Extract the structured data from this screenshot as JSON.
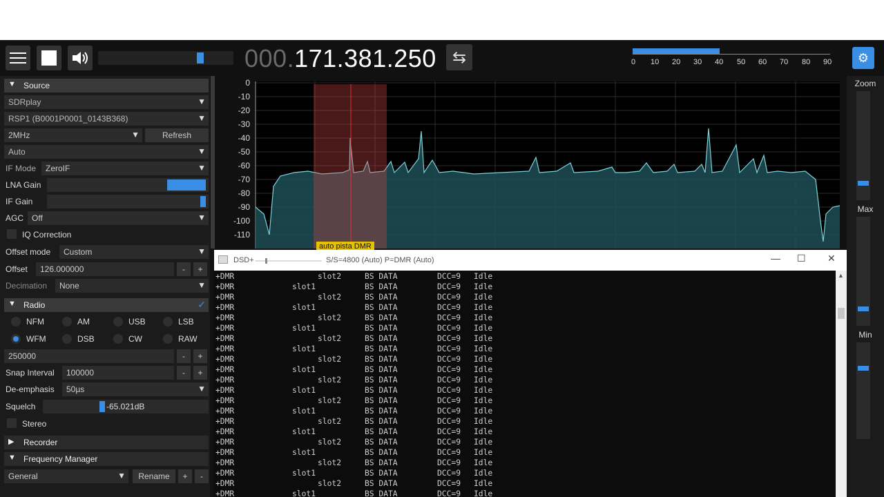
{
  "toolbar": {
    "menu_icon": "hamburger-icon",
    "stop_icon": "stop-icon",
    "volume_icon": "speaker-icon",
    "frequency_dim": "000.",
    "frequency_main": "171.381.250",
    "swap_icon": "swap-icon",
    "snr_scale": [
      "0",
      "10",
      "20",
      "30",
      "40",
      "50",
      "60",
      "70",
      "80",
      "90"
    ],
    "display_icon": "display-settings-icon",
    "accent_color": "#3a8ee6"
  },
  "source": {
    "header": "Source",
    "device": "SDRplay",
    "serial": "RSP1 (B0001P0001_0143B368)",
    "bandwidth": "2MHz",
    "refresh_label": "Refresh",
    "agc_mode": "Auto",
    "if_mode_label": "IF Mode",
    "if_mode_value": "ZeroIF",
    "lna_gain_label": "LNA Gain",
    "if_gain_label": "IF Gain",
    "agc_label": "AGC",
    "agc_value": "Off",
    "iq_correction_label": "IQ Correction",
    "offset_mode_label": "Offset mode",
    "offset_mode_value": "Custom",
    "offset_label": "Offset",
    "offset_value": "126.000000",
    "decimation_label": "Decimation",
    "decimation_value": "None",
    "minus": "-",
    "plus": "+"
  },
  "radio": {
    "header": "Radio",
    "modes_row1": [
      "NFM",
      "AM",
      "USB",
      "LSB"
    ],
    "modes_row2": [
      "WFM",
      "DSB",
      "CW",
      "RAW"
    ],
    "selected_mode": "WFM",
    "bandwidth_value": "250000",
    "snap_label": "Snap Interval",
    "snap_value": "100000",
    "deemph_label": "De-emphasis",
    "deemph_value": "50µs",
    "squelch_label": "Squelch",
    "squelch_value": "-65.021dB",
    "stereo_label": "Stereo"
  },
  "recorder": {
    "header": "Recorder"
  },
  "frequency_manager": {
    "header": "Frequency Manager",
    "list_value": "General",
    "rename_label": "Rename",
    "add_label": "+",
    "remove_label": "-"
  },
  "spectrum": {
    "db_ticks": [
      "0",
      "-10",
      "-20",
      "-30",
      "-40",
      "-50",
      "-60",
      "-70",
      "-80",
      "-90",
      "-100",
      "-110"
    ],
    "marker_label": "auto pista DMR",
    "trace_color": "#7fd4dc"
  },
  "right_panel": {
    "zoom_label": "Zoom",
    "max_label": "Max",
    "min_label": "Min"
  },
  "dsd_window": {
    "title": "DSD+",
    "status": "S/S=4800 (Auto) P=DMR (Auto)",
    "minimize": "—",
    "maximize": "☐",
    "close": "✕",
    "lines": [
      {
        "proto": "+DMR",
        "slot": "slot2",
        "type": "BS DATA",
        "dcc": "DCC=9",
        "state": "Idle",
        "indent": true
      },
      {
        "proto": "+DMR",
        "slot": "slot1",
        "type": "BS DATA",
        "dcc": "DCC=9",
        "state": "Idle",
        "indent": false
      },
      {
        "proto": "+DMR",
        "slot": "slot2",
        "type": "BS DATA",
        "dcc": "DCC=9",
        "state": "Idle",
        "indent": true
      },
      {
        "proto": "+DMR",
        "slot": "slot1",
        "type": "BS DATA",
        "dcc": "DCC=9",
        "state": "Idle",
        "indent": false
      },
      {
        "proto": "+DMR",
        "slot": "slot2",
        "type": "BS DATA",
        "dcc": "DCC=9",
        "state": "Idle",
        "indent": true
      },
      {
        "proto": "+DMR",
        "slot": "slot1",
        "type": "BS DATA",
        "dcc": "DCC=9",
        "state": "Idle",
        "indent": false
      },
      {
        "proto": "+DMR",
        "slot": "slot2",
        "type": "BS DATA",
        "dcc": "DCC=9",
        "state": "Idle",
        "indent": true
      },
      {
        "proto": "+DMR",
        "slot": "slot1",
        "type": "BS DATA",
        "dcc": "DCC=9",
        "state": "Idle",
        "indent": false
      },
      {
        "proto": "+DMR",
        "slot": "slot2",
        "type": "BS DATA",
        "dcc": "DCC=9",
        "state": "Idle",
        "indent": true
      },
      {
        "proto": "+DMR",
        "slot": "slot1",
        "type": "BS DATA",
        "dcc": "DCC=9",
        "state": "Idle",
        "indent": false
      },
      {
        "proto": "+DMR",
        "slot": "slot2",
        "type": "BS DATA",
        "dcc": "DCC=9",
        "state": "Idle",
        "indent": true
      },
      {
        "proto": "+DMR",
        "slot": "slot1",
        "type": "BS DATA",
        "dcc": "DCC=9",
        "state": "Idle",
        "indent": false
      },
      {
        "proto": "+DMR",
        "slot": "slot2",
        "type": "BS DATA",
        "dcc": "DCC=9",
        "state": "Idle",
        "indent": true
      },
      {
        "proto": "+DMR",
        "slot": "slot1",
        "type": "BS DATA",
        "dcc": "DCC=9",
        "state": "Idle",
        "indent": false
      },
      {
        "proto": "+DMR",
        "slot": "slot2",
        "type": "BS DATA",
        "dcc": "DCC=9",
        "state": "Idle",
        "indent": true
      },
      {
        "proto": "+DMR",
        "slot": "slot1",
        "type": "BS DATA",
        "dcc": "DCC=9",
        "state": "Idle",
        "indent": false
      },
      {
        "proto": "+DMR",
        "slot": "slot2",
        "type": "BS DATA",
        "dcc": "DCC=9",
        "state": "Idle",
        "indent": true
      },
      {
        "proto": "+DMR",
        "slot": "slot1",
        "type": "BS DATA",
        "dcc": "DCC=9",
        "state": "Idle",
        "indent": false
      },
      {
        "proto": "+DMR",
        "slot": "slot2",
        "type": "BS DATA",
        "dcc": "DCC=9",
        "state": "Idle",
        "indent": true
      },
      {
        "proto": "+DMR",
        "slot": "slot1",
        "type": "BS DATA",
        "dcc": "DCC=9",
        "state": "Idle",
        "indent": false
      },
      {
        "proto": "+DMR",
        "slot": "slot2",
        "type": "BS DATA",
        "dcc": "DCC=9",
        "state": "Idle",
        "indent": true
      },
      {
        "proto": "+DMR",
        "slot": "slot1",
        "type": "BS DATA",
        "dcc": "DCC=9",
        "state": "Idle",
        "indent": false
      }
    ]
  }
}
